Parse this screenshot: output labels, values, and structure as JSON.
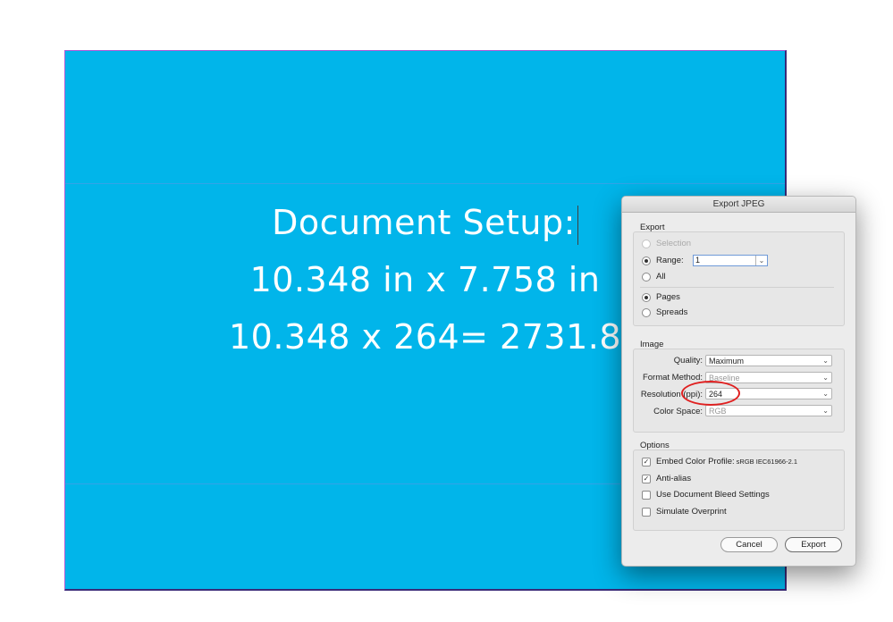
{
  "document": {
    "lines": [
      "Document Setup:",
      "10.348 in x 7.758 in",
      "10.348 x 264= 2731.8"
    ],
    "background_color": "#01b5ea"
  },
  "dialog": {
    "title": "Export JPEG",
    "export": {
      "label": "Export",
      "selection": "Selection",
      "range": "Range:",
      "range_value": "1",
      "all": "All",
      "pages": "Pages",
      "spreads": "Spreads"
    },
    "image": {
      "label": "Image",
      "quality_label": "Quality:",
      "quality_value": "Maximum",
      "format_label": "Format Method:",
      "format_value": "Baseline",
      "resolution_label": "Resolution (ppi):",
      "resolution_value": "264",
      "color_space_label": "Color Space:",
      "color_space_value": "RGB"
    },
    "options": {
      "label": "Options",
      "embed_profile": "Embed Color Profile:",
      "embed_profile_value": "sRGB IEC61966-2.1",
      "anti_alias": "Anti-alias",
      "bleed": "Use Document Bleed Settings",
      "overprint": "Simulate Overprint"
    },
    "buttons": {
      "cancel": "Cancel",
      "export": "Export"
    }
  },
  "colors": {
    "annotation": "#e02020"
  },
  "icons": {
    "dropdown": "chevron-down-icon",
    "check": "checkmark-icon"
  }
}
